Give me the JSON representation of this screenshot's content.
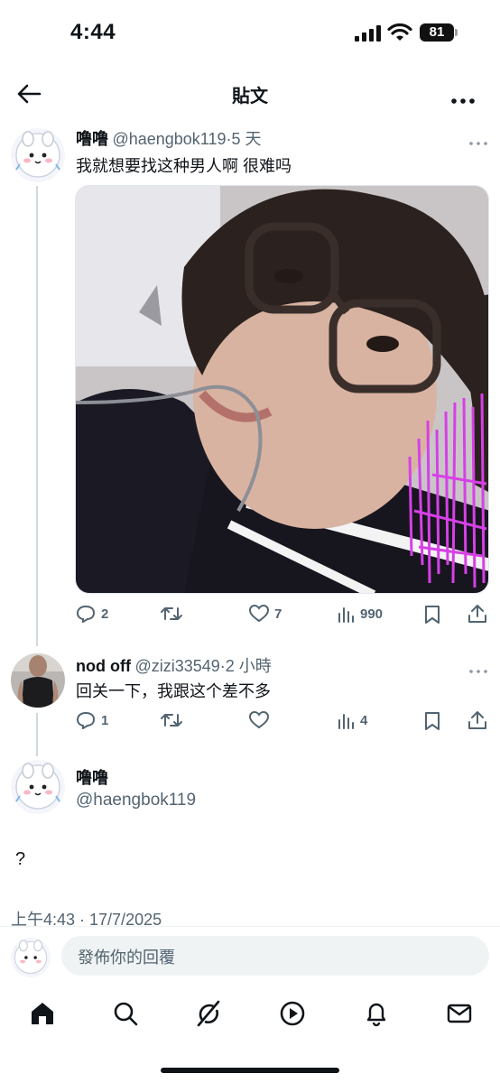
{
  "status_bar": {
    "time": "4:44",
    "battery": "81"
  },
  "header": {
    "title": "貼文"
  },
  "original_post": {
    "name": "噜噜",
    "handle": "@haengbok119",
    "time": "5 天",
    "text": "我就想要找这种男人啊 很难吗",
    "replies": "2",
    "likes": "7",
    "views": "990"
  },
  "reply_post": {
    "name": "nod off",
    "handle": "@zizi33549",
    "time": "2 小時",
    "text": "回关一下，我跟这个差不多",
    "replies": "1",
    "views": "4"
  },
  "main_post": {
    "name": "噜噜",
    "handle": "@haengbok119",
    "text": "?",
    "timestamp": "上午4:43 · 17/7/2025"
  },
  "composer": {
    "placeholder": "發佈你的回覆"
  },
  "colors": {
    "accent_pink": "#d640e6",
    "text_secondary": "#536471"
  }
}
